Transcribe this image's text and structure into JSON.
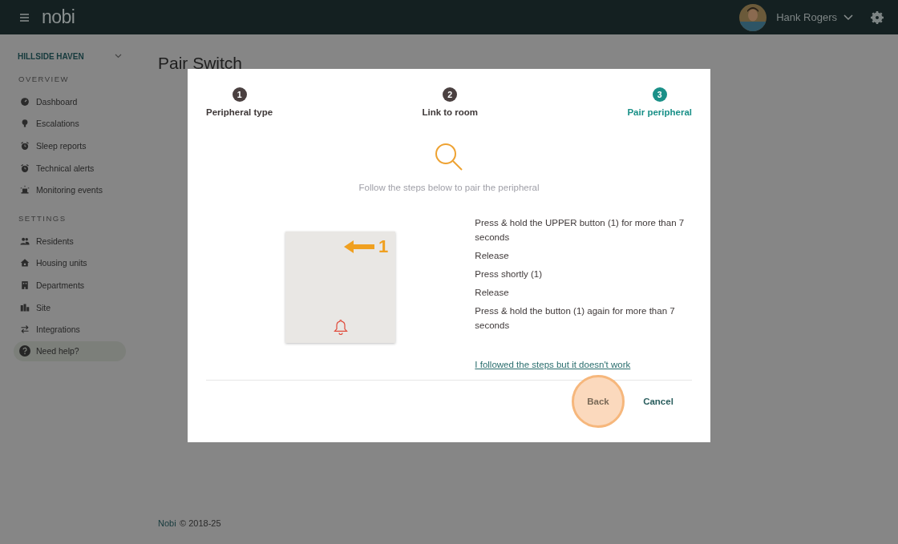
{
  "header": {
    "logo": "nobi",
    "user_name": "Hank Rogers"
  },
  "sidebar": {
    "site": "HILLSIDE HAVEN",
    "sections": [
      {
        "title": "OVERVIEW",
        "items": [
          {
            "label": "Dashboard"
          },
          {
            "label": "Escalations"
          },
          {
            "label": "Sleep reports"
          },
          {
            "label": "Technical alerts"
          },
          {
            "label": "Monitoring events"
          }
        ]
      },
      {
        "title": "SETTINGS",
        "items": [
          {
            "label": "Residents"
          },
          {
            "label": "Housing units"
          },
          {
            "label": "Departments"
          },
          {
            "label": "Site"
          },
          {
            "label": "Integrations"
          }
        ]
      }
    ],
    "help": "Need help?"
  },
  "page": {
    "title": "Pair Switch"
  },
  "dialog": {
    "steps": [
      {
        "number": "1",
        "label": "Peripheral type",
        "selected": false
      },
      {
        "number": "2",
        "label": "Link to room",
        "selected": false
      },
      {
        "number": "3",
        "label": "Pair peripheral",
        "selected": true
      }
    ],
    "subtitle": "Follow the steps below to pair the peripheral",
    "diagram_label": "1",
    "instructions": [
      "Press & hold the UPPER button (1) for more than 7 seconds",
      "Release",
      "Press shortly (1)",
      "Release",
      "Press & hold the button (1) again for more than 7 seconds"
    ],
    "help_link": "I followed the steps but it doesn't work",
    "buttons": [
      {
        "label": "Back",
        "highlighted": true
      },
      {
        "label": "Cancel",
        "highlighted": false
      }
    ]
  },
  "footer": {
    "brand": "Nobi",
    "copyright": "© 2018-25"
  }
}
